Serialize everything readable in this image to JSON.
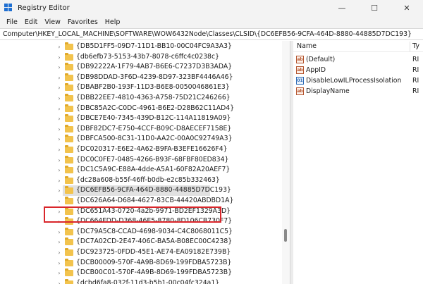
{
  "window": {
    "title": "Registry Editor",
    "minimize_glyph": "—",
    "maximize_glyph": "☐",
    "close_glyph": "✕"
  },
  "menu": [
    "File",
    "Edit",
    "View",
    "Favorites",
    "Help"
  ],
  "address": "Computer\\HKEY_LOCAL_MACHINE\\SOFTWARE\\WOW6432Node\\Classes\\CLSID\\{DC6EFB56-9CFA-464D-8880-44885D7DC193}",
  "tree": {
    "selected_index": 14,
    "items": [
      "{DB5D1FF5-09D7-11D1-BB10-00C04FC9A3A3}",
      "{db6efb73-5153-43b7-8078-c6ffc4c0238c}",
      "{DB92222A-1F79-4AB7-B6E6-C7237D3B3ADA}",
      "{DB98DDAD-3F6D-4239-8D97-323BF4446A46}",
      "{DBABF2B0-193F-11D3-B6E8-0050046861E3}",
      "{DBB22EE7-4810-4363-A758-75D21C246266}",
      "{DBC85A2C-C0DC-4961-B6E2-D28B62C11AD4}",
      "{DBCE7E40-7345-439D-B12C-114A11819A09}",
      "{DBF82DC7-E750-4CCF-B09C-D8AECEF7158E}",
      "{DBFCA500-8C31-11D0-AA2C-00A0C92749A3}",
      "{DC020317-E6E2-4A62-B9FA-B3EFE16626F4}",
      "{DC0C0FE7-0485-4266-B93F-68FBF80ED834}",
      "{DC1C5A9C-E88A-4dde-A5A1-60F82A20AEF7}",
      "{dc28a608-b55f-46ff-b0db-e2c85b332463}",
      "{DC6EFB56-9CFA-464D-8880-44885D7DC193}",
      "{DC626A64-D684-4627-83CB-44420ABDBD1A}",
      "{DC651A43-0720-4a2b-9971-BD2EF1329A3D}",
      "{DC664FDD-D368-46E5-8780-8D106CB730F7}",
      "{DC79A5C8-CCAD-4698-9034-C4C8068011C5}",
      "{DC7A02CD-2E47-406C-BA5A-B08EC00C4238}",
      "{DC923725-0FDD-45E1-AE74-EA09182E739B}",
      "{DCB00009-570F-4A9B-8D69-199FDBA5723B}",
      "{DCB00C01-570F-4A9B-8D69-199FDBA5723B}",
      "{dcbd6fa8-032f-11d3-b5b1-00c04fc324a1}"
    ],
    "expand_glyph": "›"
  },
  "values": {
    "col_name": "Name",
    "col_type": "Ty",
    "rows": [
      {
        "name": "(Default)",
        "type": "RI",
        "icon": "ab"
      },
      {
        "name": "AppID",
        "type": "RI",
        "icon": "ab"
      },
      {
        "name": "DisableLowILProcessIsolation",
        "type": "RI",
        "icon": "bin"
      },
      {
        "name": "DisplayName",
        "type": "RI",
        "icon": "ab"
      }
    ]
  },
  "colors": {
    "highlight_border": "#d9262b",
    "folder": "#f2c34d",
    "selection": "#e1e1e1"
  }
}
